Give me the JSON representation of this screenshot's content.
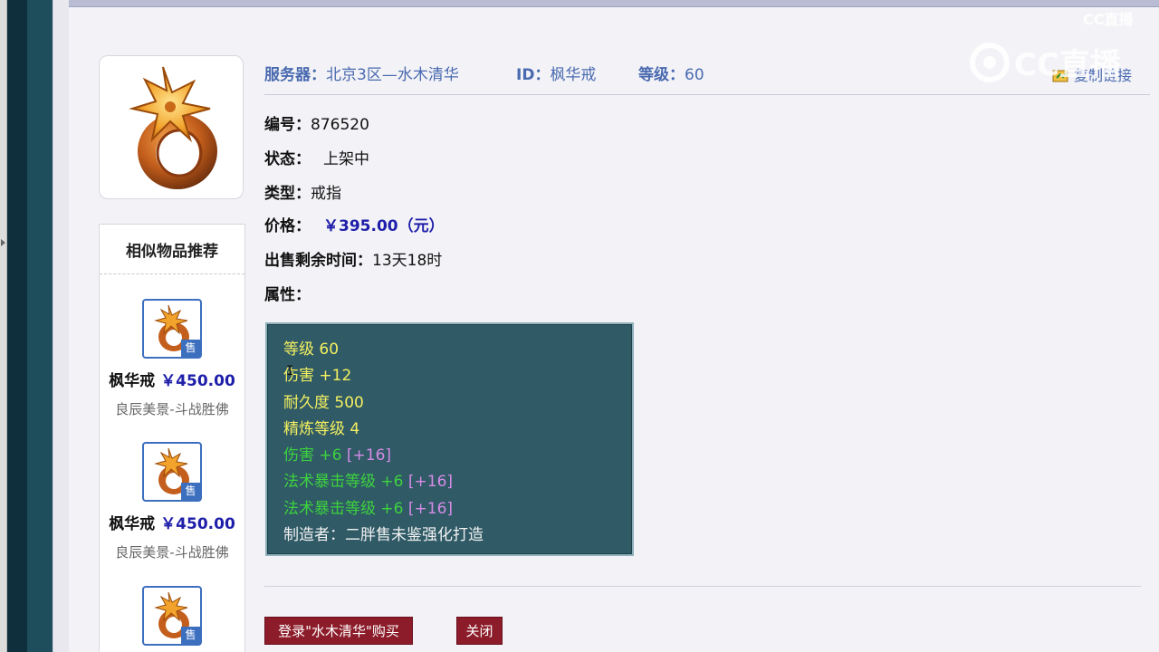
{
  "header": {
    "server_label": "服务器：",
    "server_value": "北京3区—水木清华",
    "id_label": "ID：",
    "id_value": "枫华戒",
    "level_label": "等级：",
    "level_value": "60",
    "copy_link": "复制链接"
  },
  "details": {
    "number_label": "编号：",
    "number_value": "876520",
    "status_label": "状态：",
    "status_value": "上架中",
    "type_label": "类型：",
    "type_value": "戒指",
    "price_label": "价格：",
    "price_value": "￥395.00（元）",
    "remaining_label": "出售剩余时间：",
    "remaining_value": "13天18时",
    "attributes_label": "属性："
  },
  "attributes": [
    {
      "text": "等级 60",
      "extra": "",
      "color": "#f4f060"
    },
    {
      "text": "伤害 +12",
      "extra": "",
      "color": "#f4f060"
    },
    {
      "text": "耐久度 500",
      "extra": "",
      "color": "#f4f060"
    },
    {
      "text": "精炼等级 4",
      "extra": "",
      "color": "#f4f060"
    },
    {
      "text": "伤害 +6",
      "extra": "[+16]",
      "color": "#3ed23e"
    },
    {
      "text": "法术暴击等级 +6",
      "extra": "[+16]",
      "color": "#3ed23e"
    },
    {
      "text": "法术暴击等级 +6",
      "extra": "[+16]",
      "color": "#3ed23e"
    },
    {
      "text": "制造者：二胖售未鉴强化打造",
      "extra": "",
      "color": "#f2f2f2"
    }
  ],
  "buttons": {
    "buy": "登录\"水木清华\"购买",
    "close": "关闭"
  },
  "sidebar": {
    "title": "相似物品推荐",
    "sale_tag": "售",
    "items": [
      {
        "name": "枫华戒",
        "price": "￥450.00",
        "desc": "良辰美景-斗战胜佛"
      },
      {
        "name": "枫华戒",
        "price": "￥450.00",
        "desc": "良辰美景-斗战胜佛"
      },
      {
        "name": "",
        "price": "",
        "desc": ""
      }
    ]
  },
  "watermark": {
    "small": "CC直播",
    "large": "CC直播"
  },
  "colors": {
    "accent_blue": "#4a6ab0",
    "price_blue": "#1e1eaa",
    "button_red": "#8c1c2a",
    "attr_box_bg": "#2f5a66"
  },
  "icons": {
    "item": "maple-ring-icon",
    "copy": "copy-link-icon"
  }
}
